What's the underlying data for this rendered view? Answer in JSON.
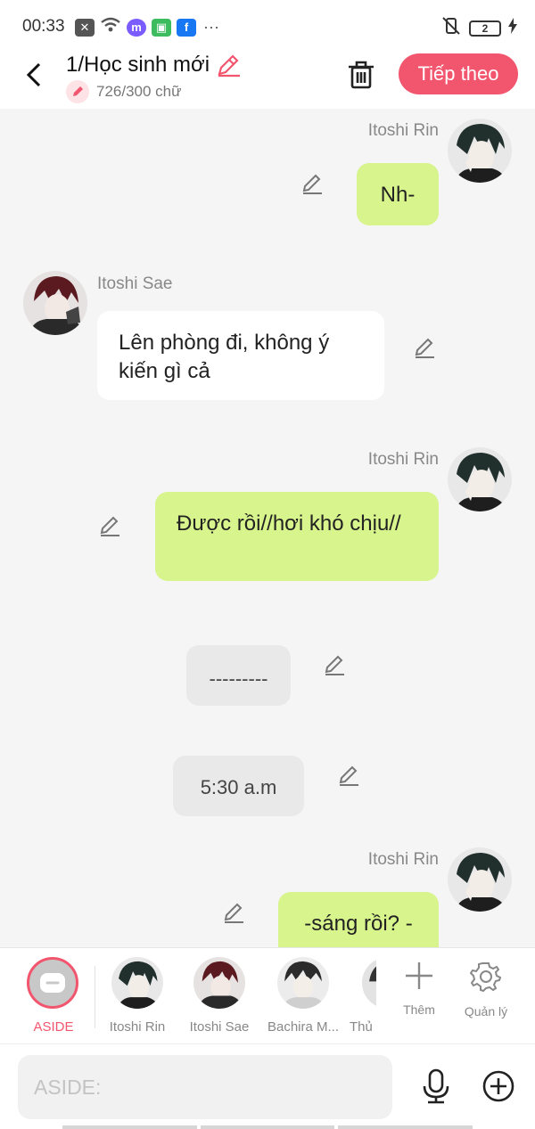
{
  "status_bar": {
    "time": "00:33",
    "dots": "···",
    "battery": "2"
  },
  "header": {
    "title": "1/Học sinh mới",
    "word_count": "726/300 chữ",
    "next_label": "Tiếp theo",
    "accent_color": "#f2566e"
  },
  "messages": [
    {
      "speaker": "Itoshi Rin",
      "text": "Nh-",
      "side": "right",
      "style": "green"
    },
    {
      "speaker": "Itoshi Sae",
      "text": "Lên phòng đi, không ý kiến gì cả",
      "side": "left",
      "style": "white"
    },
    {
      "speaker": "Itoshi Rin",
      "text": "Được rồi//hơi khó chịu//",
      "side": "right",
      "style": "green"
    },
    {
      "speaker": "",
      "text": "---------",
      "side": "center",
      "style": "aside"
    },
    {
      "speaker": "",
      "text": "5:30 a.m",
      "side": "center",
      "style": "aside"
    },
    {
      "speaker": "Itoshi Rin",
      "text": "-sáng rồi? -",
      "side": "right",
      "style": "green"
    }
  ],
  "character_bar": {
    "aside_label": "ASIDE",
    "characters": [
      {
        "name": "Itoshi Rin"
      },
      {
        "name": "Itoshi Sae"
      },
      {
        "name": "Bachira M..."
      },
      {
        "name": "Thủ"
      }
    ],
    "add_label": "Thêm",
    "manage_label": "Quản lý"
  },
  "input": {
    "placeholder": "ASIDE:"
  },
  "colors": {
    "green_bubble": "#d8f48c",
    "background": "#f5f5f5",
    "accent": "#f2566e"
  }
}
